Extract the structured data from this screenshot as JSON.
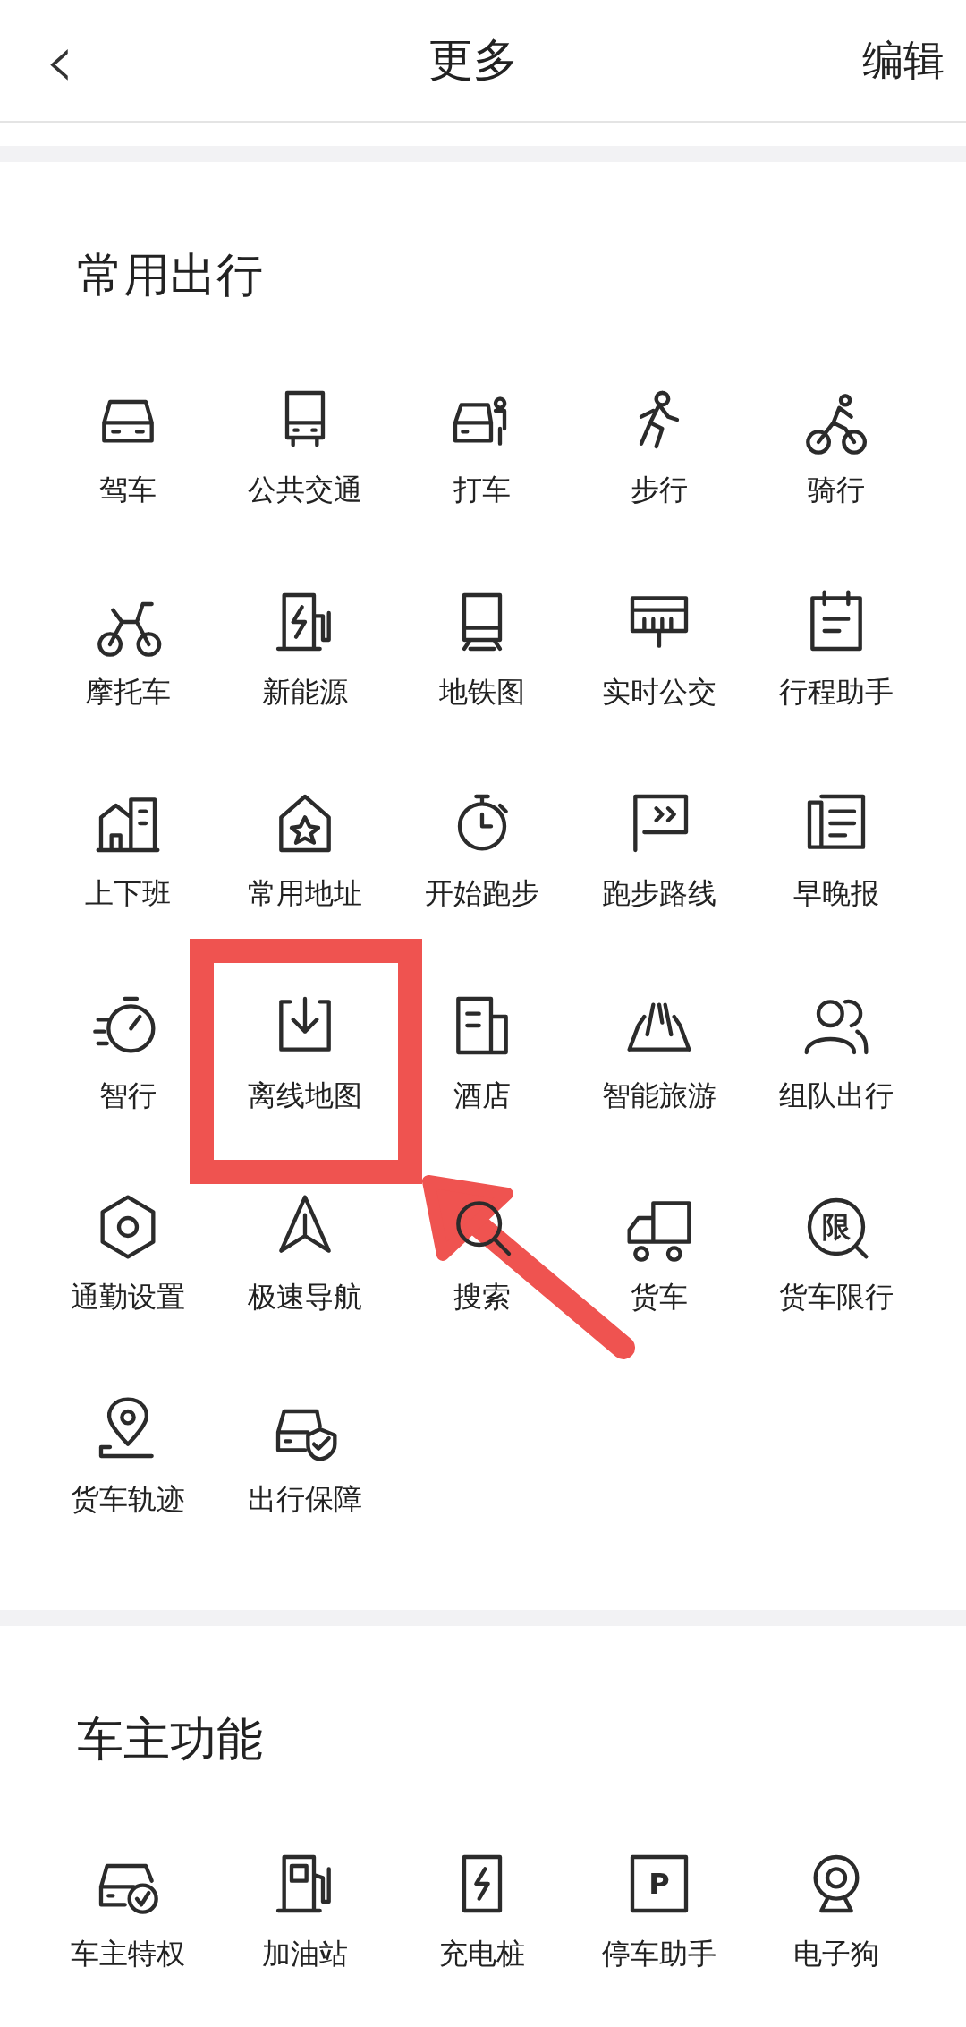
{
  "header": {
    "back": "‹",
    "title": "更多",
    "action": "编辑"
  },
  "sections": [
    {
      "title": "常用出行",
      "items": [
        {
          "label": "驾车",
          "highlighted": false
        },
        {
          "label": "公共交通",
          "highlighted": false
        },
        {
          "label": "打车",
          "highlighted": false
        },
        {
          "label": "步行",
          "highlighted": false
        },
        {
          "label": "骑行",
          "highlighted": false
        },
        {
          "label": "摩托车",
          "highlighted": false
        },
        {
          "label": "新能源",
          "highlighted": false
        },
        {
          "label": "地铁图",
          "highlighted": false
        },
        {
          "label": "实时公交",
          "highlighted": false
        },
        {
          "label": "行程助手",
          "highlighted": false
        },
        {
          "label": "上下班",
          "highlighted": false
        },
        {
          "label": "常用地址",
          "highlighted": false
        },
        {
          "label": "开始跑步",
          "highlighted": false
        },
        {
          "label": "跑步路线",
          "highlighted": false
        },
        {
          "label": "早晚报",
          "highlighted": false
        },
        {
          "label": "智行",
          "highlighted": false
        },
        {
          "label": "离线地图",
          "highlighted": true
        },
        {
          "label": "酒店",
          "highlighted": false
        },
        {
          "label": "智能旅游",
          "highlighted": false
        },
        {
          "label": "组队出行",
          "highlighted": false
        },
        {
          "label": "通勤设置",
          "highlighted": false
        },
        {
          "label": "极速导航",
          "highlighted": false
        },
        {
          "label": "搜索",
          "highlighted": false
        },
        {
          "label": "货车",
          "highlighted": false
        },
        {
          "label": "货车限行",
          "icon_text": "限",
          "highlighted": false
        },
        {
          "label": "货车轨迹",
          "highlighted": false
        },
        {
          "label": "出行保障",
          "highlighted": false
        }
      ]
    },
    {
      "title": "车主功能",
      "items": [
        {
          "label": "车主特权",
          "highlighted": false
        },
        {
          "label": "加油站",
          "highlighted": false
        },
        {
          "label": "充电桩",
          "highlighted": false
        },
        {
          "label": "停车助手",
          "icon_text": "P",
          "highlighted": false
        },
        {
          "label": "电子狗",
          "highlighted": false
        }
      ]
    }
  ]
}
